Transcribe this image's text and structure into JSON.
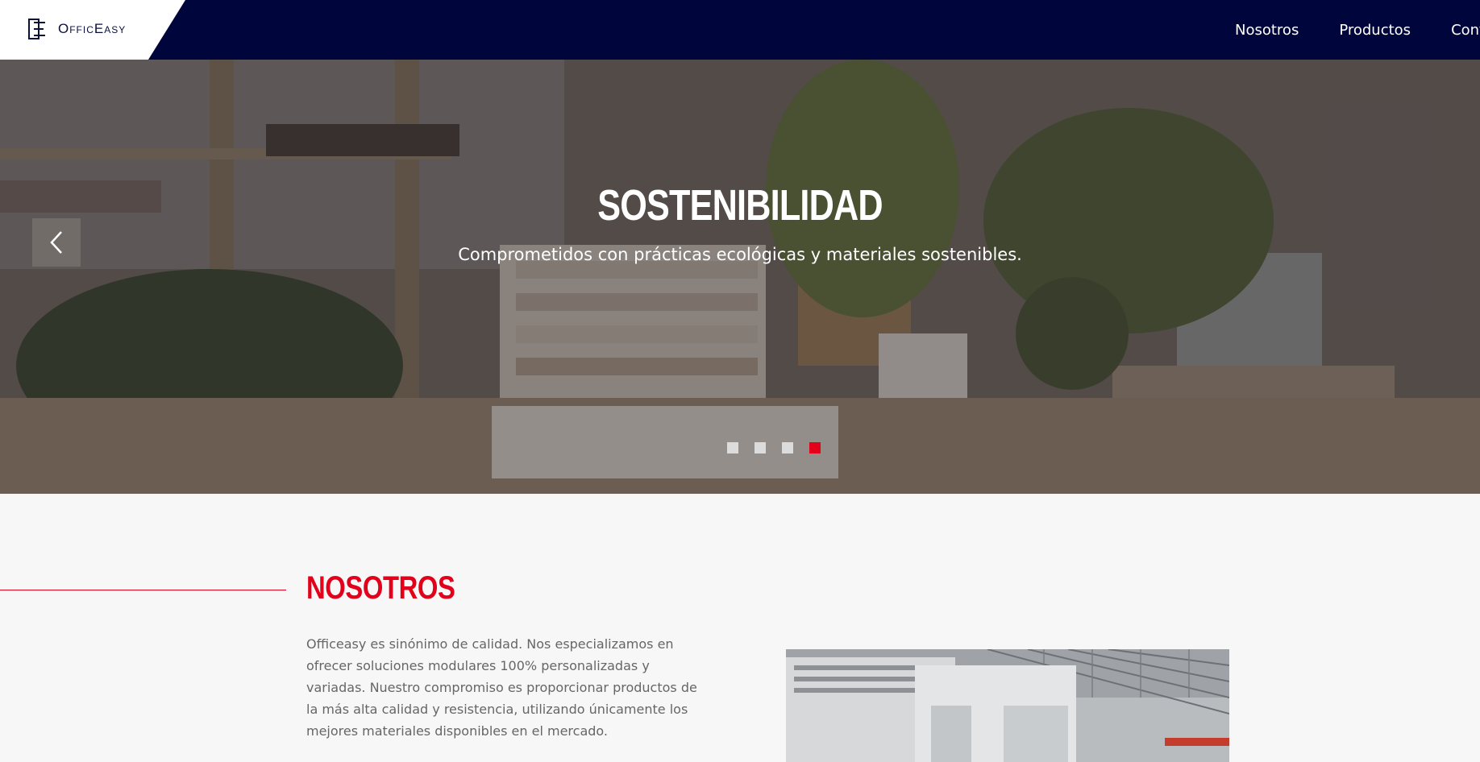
{
  "header": {
    "logo_text": "OfficEasy",
    "nav": [
      {
        "label": "Nosotros"
      },
      {
        "label": "Productos"
      },
      {
        "label": "Conta"
      }
    ]
  },
  "hero": {
    "title": "SOSTENIBILIDAD",
    "subtitle": "Comprometidos con prácticas ecológicas y materiales sostenibles.",
    "prev_icon": "chevron-left-icon",
    "slides_total": 4,
    "active_slide": 4
  },
  "about": {
    "title": "NOSOTROS",
    "paragraph": "Officeasy es sinónimo de calidad. Nos especializamos en ofrecer soluciones modulares 100% personalizadas y variadas. Nuestro compromiso es proporcionar productos de la más alta calidad y resistencia, utilizando únicamente los mejores materiales disponibles en el mercado."
  },
  "colors": {
    "header_bg": "#00053b",
    "accent": "#e2001a",
    "page_bg": "#f7f7f7"
  }
}
